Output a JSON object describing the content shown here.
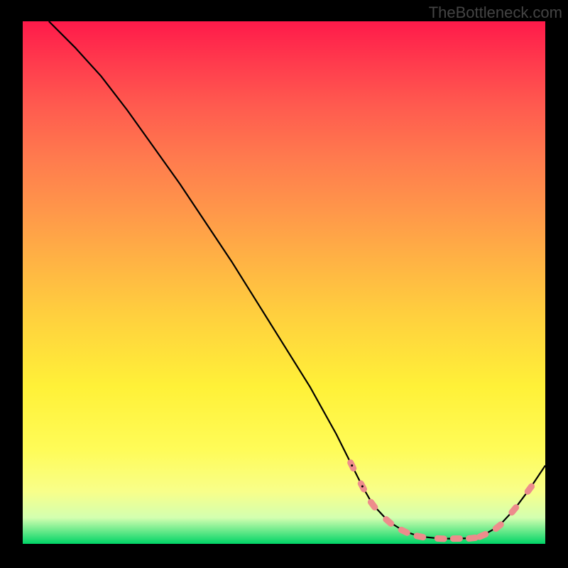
{
  "watermark": "TheBottleneck.com",
  "chart_data": {
    "type": "line",
    "title": "",
    "xlabel": "",
    "ylabel": "",
    "xlim": [
      0,
      100
    ],
    "ylim": [
      0,
      100
    ],
    "curve": {
      "x": [
        5,
        10,
        15,
        20,
        25,
        30,
        35,
        40,
        45,
        50,
        55,
        60,
        63,
        65,
        67,
        70,
        73,
        76,
        80,
        83,
        86,
        88,
        91,
        94,
        97,
        100
      ],
      "y": [
        100,
        95,
        89.5,
        83,
        76,
        69,
        61.5,
        54,
        46,
        38,
        30,
        21,
        15,
        11,
        7.5,
        4.3,
        2.4,
        1.4,
        1,
        1,
        1.1,
        1.6,
        3.3,
        6.5,
        10.5,
        15
      ]
    },
    "markers": {
      "x": [
        63,
        65,
        67,
        70,
        73,
        76,
        80,
        83,
        86,
        88,
        91,
        94,
        97
      ],
      "y": [
        15,
        11,
        7.5,
        4.3,
        2.4,
        1.4,
        1,
        1,
        1.1,
        1.6,
        3.3,
        6.5,
        10.5
      ],
      "color": "#ed8c8c",
      "shape": "pill"
    }
  }
}
